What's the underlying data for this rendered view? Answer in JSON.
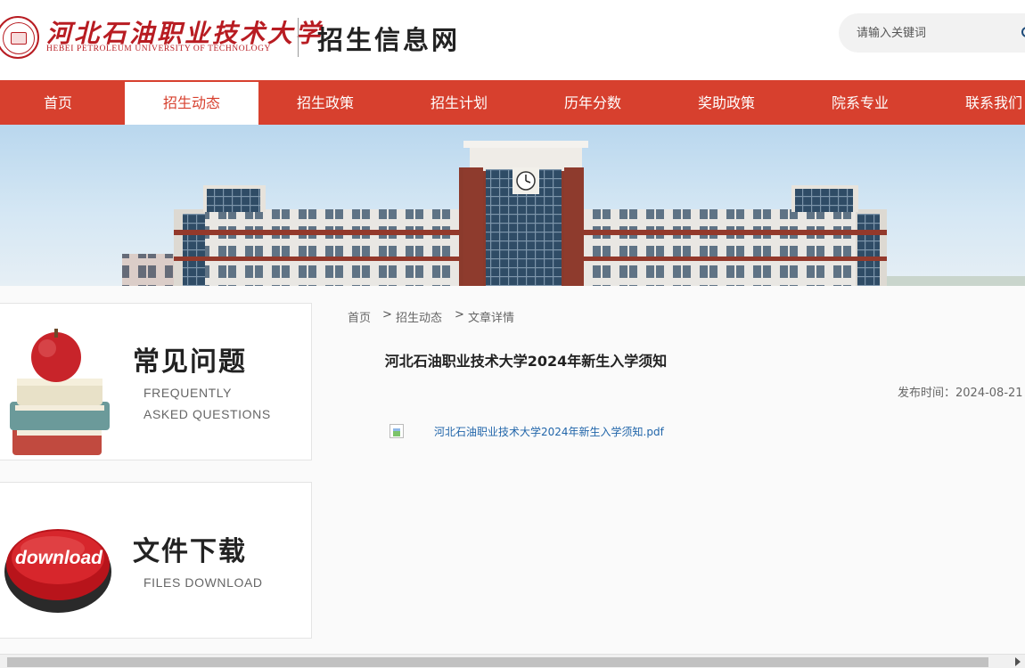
{
  "header": {
    "logo_cn": "河北石油职业技术大学",
    "logo_en": "HEBEI PETROLEUM UNIVERSITY OF TECHNOLOGY",
    "site_title": "招生信息网",
    "search_placeholder": "请输入关键词",
    "search_value": ""
  },
  "nav": {
    "items": [
      {
        "label": "首页"
      },
      {
        "label": "招生动态",
        "active": true
      },
      {
        "label": "招生政策"
      },
      {
        "label": "招生计划"
      },
      {
        "label": "历年分数"
      },
      {
        "label": "奖助政策"
      },
      {
        "label": "院系专业"
      },
      {
        "label": "联系我们"
      }
    ]
  },
  "sidebar": {
    "faq": {
      "title": "常见问题",
      "sub1": "FREQUENTLY",
      "sub2": "ASKED QUESTIONS"
    },
    "download": {
      "title": "文件下载",
      "sub": "FILES DOWNLOAD",
      "button_text": "download"
    }
  },
  "breadcrumb": {
    "home": "首页",
    "sep": ">",
    "section": "招生动态",
    "current": "文章详情"
  },
  "article": {
    "title": "河北石油职业技术大学2024年新生入学须知",
    "date": "发布时间：2024-08-21",
    "attachment": "河北石油职业技术大学2024年新生入学须知.pdf"
  },
  "colors": {
    "brand_red": "#d7402e",
    "logo_red": "#b81c22",
    "link_blue": "#2266aa"
  }
}
